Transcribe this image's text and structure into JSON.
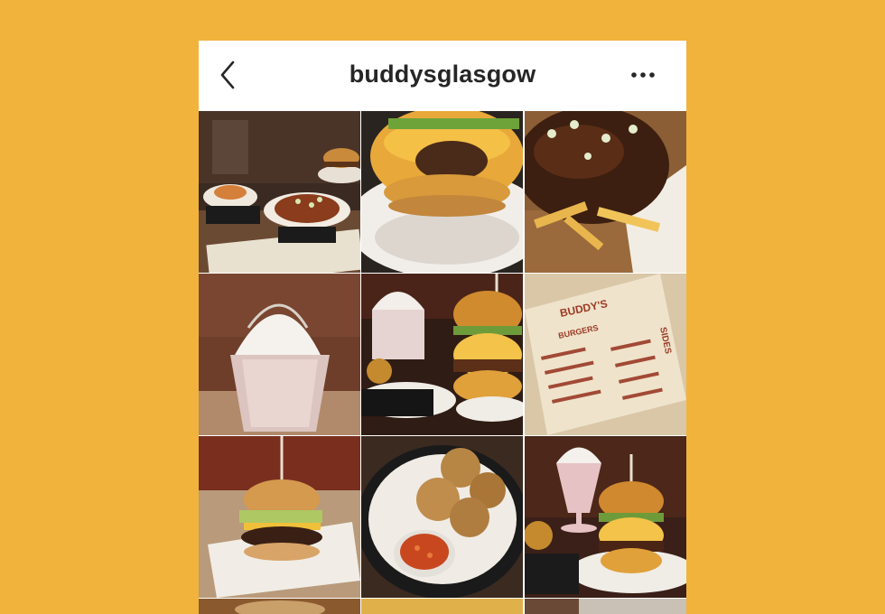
{
  "header": {
    "username": "buddysglasgow",
    "back_icon": "chevron-left-icon",
    "more_icon": "more-horizontal-icon"
  },
  "colors": {
    "background": "#F2B33D",
    "header_bg": "#FFFFFF",
    "title_text": "#262626"
  },
  "posts": [
    {
      "name": "post-loaded-fries-and-burger"
    },
    {
      "name": "post-cheeseburger-closeup"
    },
    {
      "name": "post-gravy-fries"
    },
    {
      "name": "post-milkshake"
    },
    {
      "name": "post-milkshake-and-burger"
    },
    {
      "name": "post-menu-card",
      "menu_brand": "BUDDY'S",
      "menu_section": "BURGERS",
      "menu_sides": "SIDES"
    },
    {
      "name": "post-burger-on-paper"
    },
    {
      "name": "post-breaded-bites-with-dip"
    },
    {
      "name": "post-burger-and-shake"
    },
    {
      "name": "post-partial-row-1"
    },
    {
      "name": "post-partial-row-2"
    },
    {
      "name": "post-partial-row-3"
    }
  ]
}
